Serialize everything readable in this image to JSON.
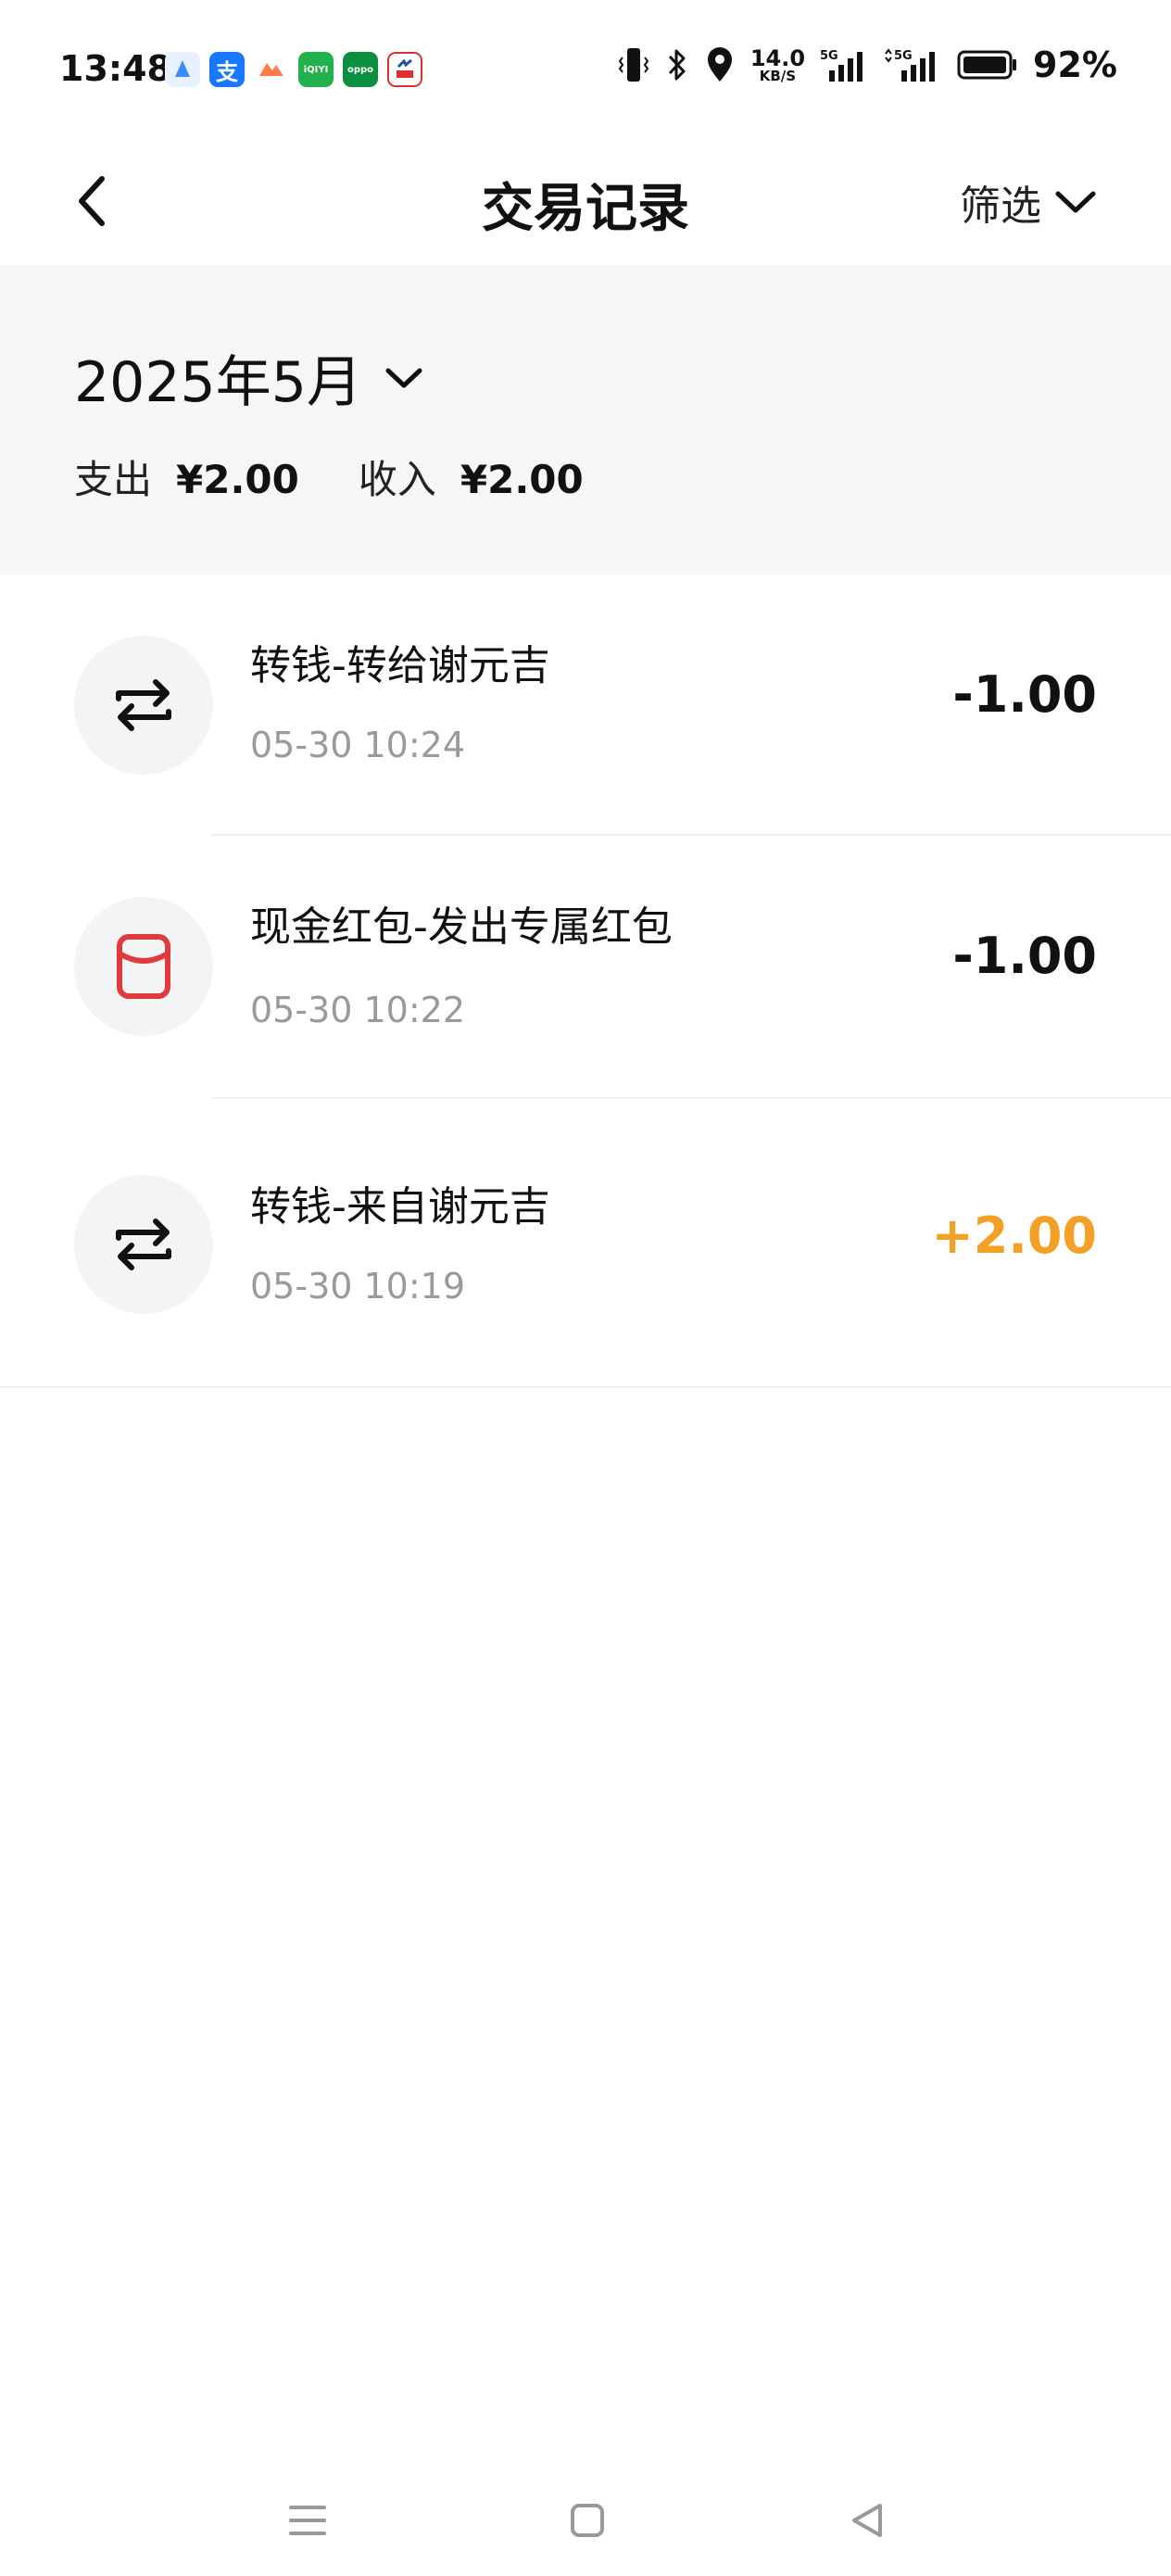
{
  "status_bar": {
    "time": "13:48",
    "notification_icons": [
      {
        "name": "browser-icon",
        "label": "",
        "color": "#3d8bff"
      },
      {
        "name": "alipay-icon",
        "label": "支",
        "color": "#1677ff"
      },
      {
        "name": "game-icon",
        "label": "",
        "color": "#ff7a45"
      },
      {
        "name": "iqiyi-icon",
        "label": "iQIYI",
        "color": "#22b14c"
      },
      {
        "name": "oppo-icon",
        "label": "oppo",
        "color": "#0a8f3f"
      },
      {
        "name": "news-icon",
        "label": "",
        "color": "#e02e2e"
      }
    ],
    "net_speed_value": "14.0",
    "net_speed_unit": "KB/S",
    "battery": "92%"
  },
  "header": {
    "title": "交易记录",
    "filter_label": "筛选"
  },
  "summary": {
    "month": "2025年5月",
    "expense_label": "支出",
    "expense_value": "¥2.00",
    "income_label": "收入",
    "income_value": "¥2.00"
  },
  "transactions": [
    {
      "title": "转钱-转给谢元吉",
      "time": "05-30 10:24",
      "amount": "-1.00",
      "icon": "transfer-icon",
      "type": "expense"
    },
    {
      "title": "现金红包-发出专属红包",
      "time": "05-30 10:22",
      "amount": "-1.00",
      "icon": "red-packet-icon",
      "type": "expense"
    },
    {
      "title": "转钱-来自谢元吉",
      "time": "05-30 10:19",
      "amount": "+2.00",
      "icon": "transfer-icon",
      "type": "income"
    }
  ],
  "colors": {
    "income": "#f2a126",
    "red_packet": "#e0393e",
    "summary_bg": "#f5f6f8"
  }
}
